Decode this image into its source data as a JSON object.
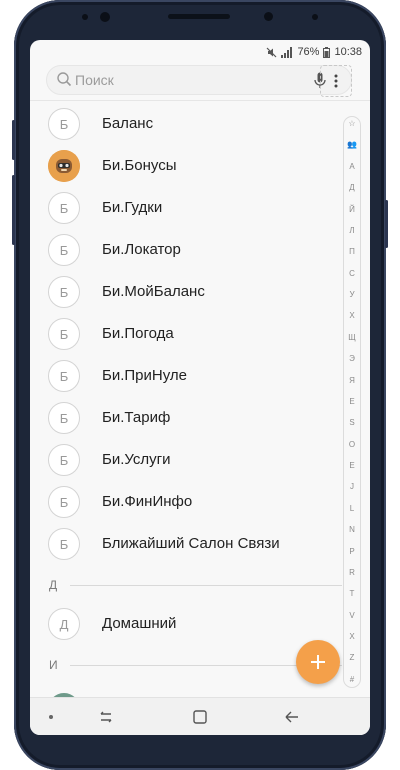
{
  "status_bar": {
    "battery": "76%",
    "time": "10:38",
    "icons": [
      "mute-icon",
      "signal-icon",
      "battery-icon"
    ]
  },
  "search": {
    "placeholder": "Поиск",
    "icons": [
      "search-icon",
      "mic-icon",
      "more-vertical-icon"
    ]
  },
  "contacts_b": [
    {
      "initial": "Б",
      "name": "Баланс"
    },
    {
      "initial": "",
      "name": "Би.Бонусы",
      "avatar": "photo"
    },
    {
      "initial": "Б",
      "name": "Би.Гудки"
    },
    {
      "initial": "Б",
      "name": "Би.Локатор"
    },
    {
      "initial": "Б",
      "name": "Би.МойБаланс"
    },
    {
      "initial": "Б",
      "name": "Би.Погода"
    },
    {
      "initial": "Б",
      "name": "Би.ПриНуле"
    },
    {
      "initial": "Б",
      "name": "Би.Тариф"
    },
    {
      "initial": "Б",
      "name": "Би.Услуги"
    },
    {
      "initial": "Б",
      "name": "Би.ФинИнфо"
    },
    {
      "initial": "Б",
      "name": "Ближайший Салон Связи"
    }
  ],
  "section_d": {
    "letter": "Д"
  },
  "contacts_d": [
    {
      "initial": "Д",
      "name": "Домашний"
    }
  ],
  "section_i": {
    "letter": "И"
  },
  "index_letters": [
    "☆",
    "👥",
    "А",
    "Д",
    "Й",
    "Л",
    "П",
    "С",
    "У",
    "Х",
    "Щ",
    "Э",
    "Я",
    "Е",
    "Ѕ",
    "О",
    "Е",
    "J",
    "L",
    "N",
    "P",
    "R",
    "T",
    "V",
    "X",
    "Z",
    "#"
  ],
  "colors": {
    "accent": "#f4a04a",
    "background": "#f8f8f8",
    "text": "#222222",
    "muted": "#9c9c9c"
  }
}
